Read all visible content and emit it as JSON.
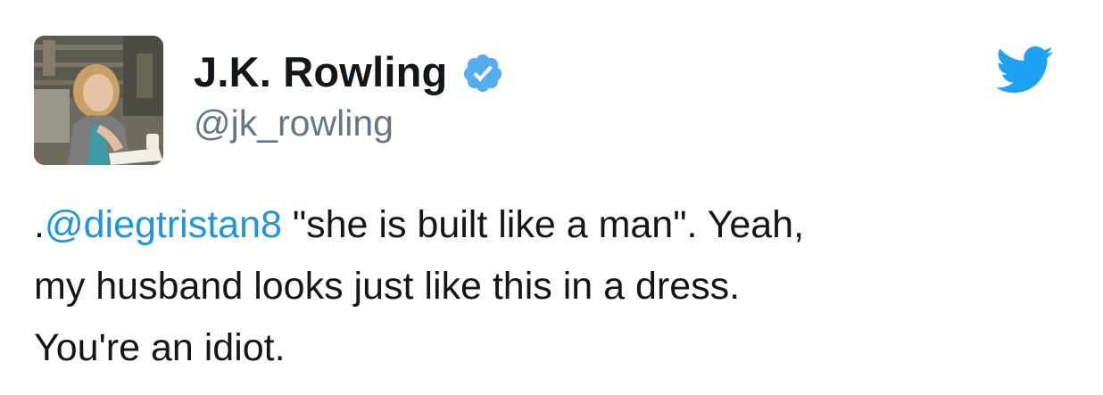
{
  "tweet": {
    "author": {
      "display_name": "J.K. Rowling",
      "handle": "@jk_rowling",
      "verified": true,
      "avatar_icon": "profile-photo"
    },
    "brand_icon": "twitter-bird-icon",
    "text_lines": [
      {
        "prefix": ".",
        "mention": "@diegtristan8",
        "rest": " \"she is built like a man\". Yeah,"
      },
      {
        "text": "my husband looks just like this in a dress."
      },
      {
        "text": "You're an idiot."
      }
    ]
  },
  "colors": {
    "brand_blue": "#1da1f2",
    "mention_blue": "#1b95e0",
    "verified_blue": "#55acee",
    "handle_gray": "#657786",
    "text_dark": "#14171a"
  }
}
